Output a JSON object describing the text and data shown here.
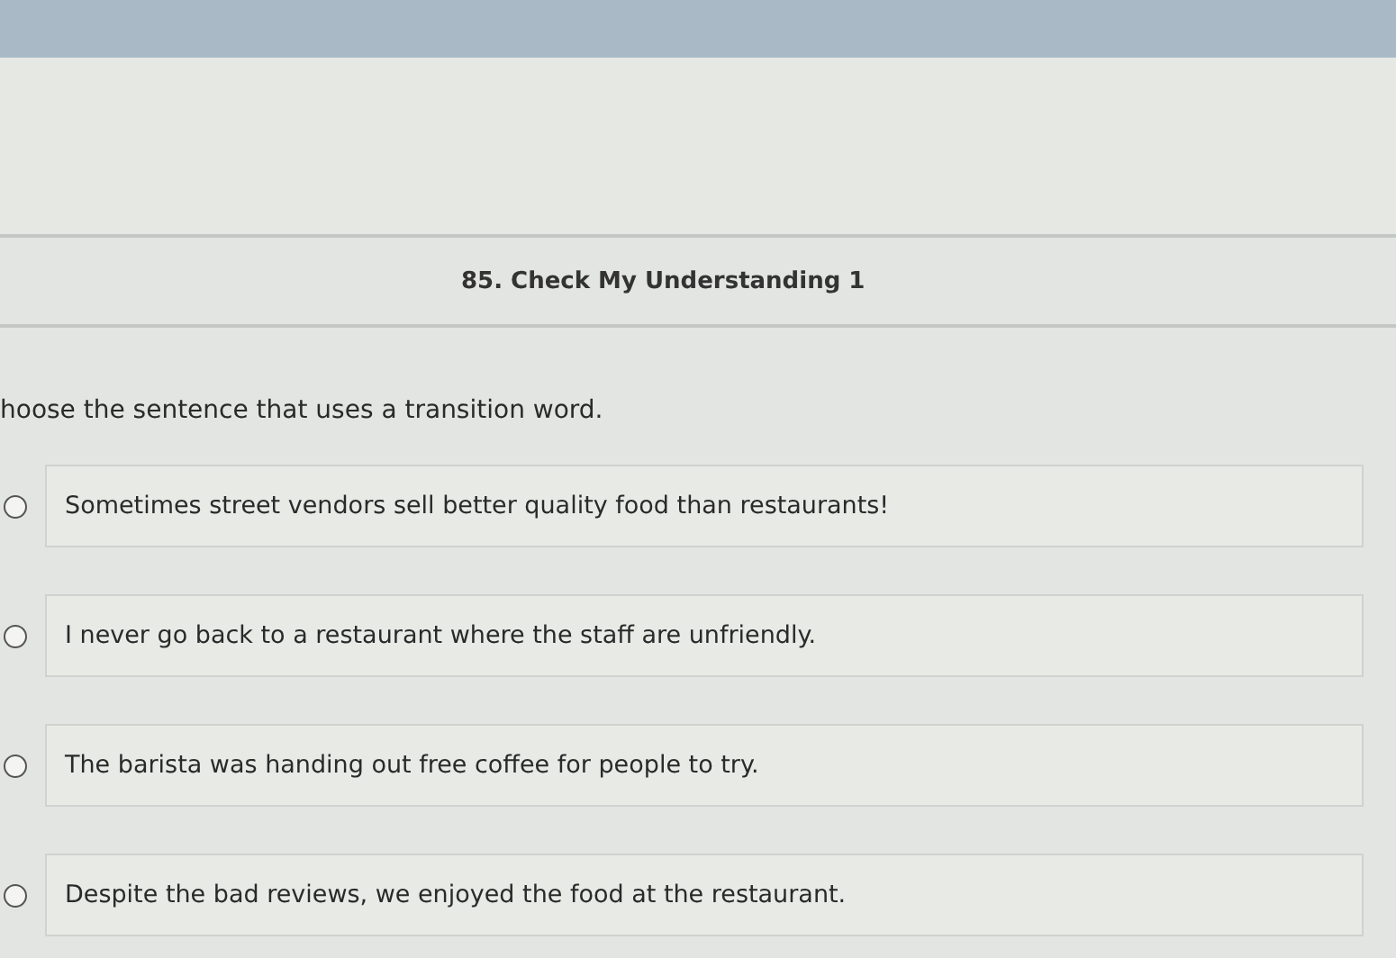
{
  "title": "85. Check My Understanding 1",
  "question": "hoose the sentence that uses a transition word.",
  "options": [
    {
      "label": "Sometimes street vendors sell better quality food than restaurants!",
      "selected": false
    },
    {
      "label": "I never go back to a restaurant where the staff are unfriendly.",
      "selected": false
    },
    {
      "label": "The barista was handing out free coffee for people to try.",
      "selected": false
    },
    {
      "label": "Despite the bad reviews, we enjoyed the food at the restaurant.",
      "selected": false
    }
  ]
}
